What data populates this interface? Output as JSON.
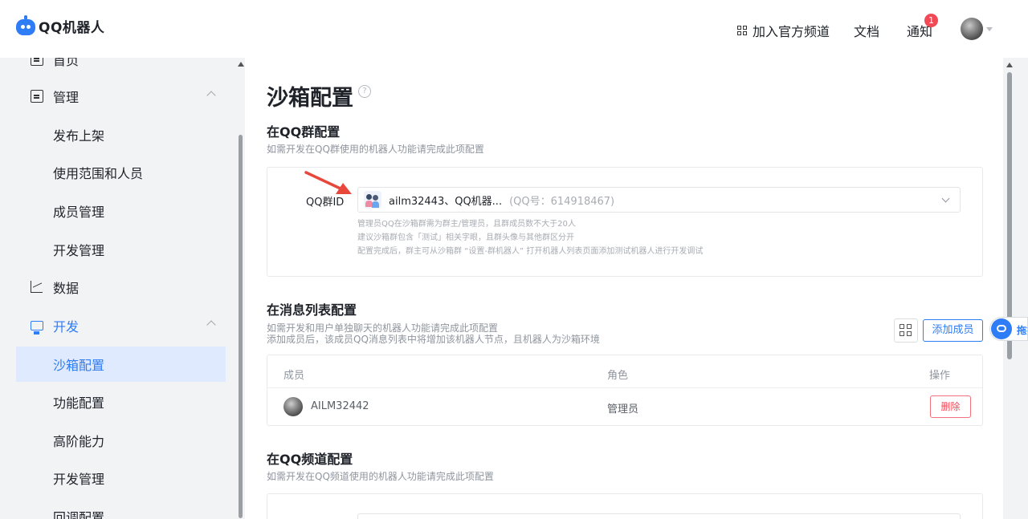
{
  "header": {
    "logo_text": "QQ机器人",
    "nav": {
      "join_channel": "加入官方频道",
      "docs": "文档",
      "notify": "通知",
      "notify_count": "1"
    }
  },
  "sidebar": {
    "items": [
      {
        "label": "首页"
      },
      {
        "label": "管理"
      },
      {
        "label": "发布上架"
      },
      {
        "label": "使用范围和人员"
      },
      {
        "label": "成员管理"
      },
      {
        "label": "开发管理"
      },
      {
        "label": "数据"
      },
      {
        "label": "开发"
      },
      {
        "label": "沙箱配置"
      },
      {
        "label": "功能配置"
      },
      {
        "label": "高阶能力"
      },
      {
        "label": "开发管理"
      },
      {
        "label": "回调配置"
      }
    ]
  },
  "main": {
    "title": "沙箱配置",
    "group_section": {
      "title": "在QQ群配置",
      "desc": "如需开发在QQ群使用的机器人功能请完成此项配置",
      "field_label": "QQ群ID",
      "selected_name": "ailm32443、QQ机器...",
      "selected_qq": "(QQ号：614918467)",
      "hints": [
        "管理员QQ在沙箱群需为群主/管理员，且群成员数不大于20人",
        "建议沙箱群包含「测试」相关字眼，且群头像与其他群区分开",
        "配置完成后，群主可从沙箱群 “设置-群机器人” 打开机器人列表页面添加测试机器人进行开发调试"
      ]
    },
    "message_section": {
      "title": "在消息列表配置",
      "desc_1": "如需开发和用户单独聊天的机器人功能请完成此项配置",
      "desc_2": "添加成员后，该成员QQ消息列表中将增加该机器人节点，且机器人为沙箱环境",
      "add_button": "添加成员",
      "table": {
        "headers": [
          "成员",
          "角色",
          "操作"
        ],
        "rows": [
          {
            "member": "AILM32442",
            "role": "管理员",
            "action": "删除"
          }
        ]
      }
    },
    "channel_section": {
      "title": "在QQ频道配置",
      "desc": "如需开发在QQ频道使用的机器人功能请完成此项配置"
    }
  },
  "float_button": {
    "label": "拖拽"
  },
  "colors": {
    "accent": "#2e7cf6",
    "danger": "#f24957",
    "active_bg": "#dfeafe"
  }
}
